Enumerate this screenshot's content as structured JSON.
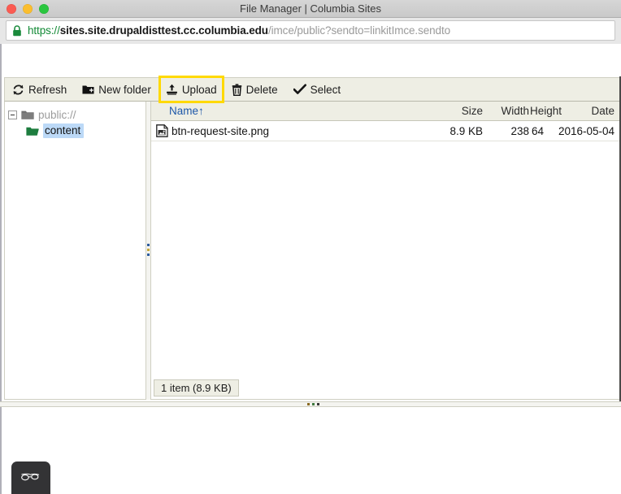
{
  "window": {
    "title": "File Manager | Columbia Sites",
    "traffic_lights": [
      {
        "name": "close",
        "color": "#fb5b52"
      },
      {
        "name": "minimize",
        "color": "#fbbe2e"
      },
      {
        "name": "maximize",
        "color": "#2ac63f"
      }
    ]
  },
  "urlbar": {
    "lock_icon": "padlock-icon",
    "scheme": "https",
    "separator": "://",
    "host": "sites.site.drupaldisttest.cc.columbia.edu",
    "path": "/imce/public?sendto=linkitImce.sendto",
    "full_url": "https://sites.site.drupaldisttest.cc.columbia.edu/imce/public?sendto=linkitImce.sendto",
    "scheme_color": "#138a36",
    "host_color": "#181818",
    "path_color": "#9a9a9a"
  },
  "toolbar": {
    "buttons": [
      {
        "label": "Refresh",
        "icon": "refresh-icon",
        "highlighted": false
      },
      {
        "label": "New folder",
        "icon": "new-folder-icon",
        "highlighted": false
      },
      {
        "label": "Upload",
        "icon": "upload-icon",
        "highlighted": true
      },
      {
        "label": "Delete",
        "icon": "trash-icon",
        "highlighted": false
      },
      {
        "label": "Select",
        "icon": "checkmark-icon",
        "highlighted": false
      }
    ],
    "highlight_color": "#ffd900"
  },
  "tree": {
    "nodes": [
      {
        "label": "public://",
        "icon": "folder-closed-icon",
        "expanded": true,
        "selected": false,
        "level": 1
      },
      {
        "label": "content",
        "icon": "folder-open-icon",
        "expanded": false,
        "selected": true,
        "level": 2
      }
    ],
    "selection_color": "#bcd9f7"
  },
  "filelist": {
    "columns": [
      {
        "key": "name",
        "label": "Name",
        "sorted": true,
        "sort_indicator": "↑"
      },
      {
        "key": "size",
        "label": "Size",
        "sorted": false
      },
      {
        "key": "width",
        "label": "Width",
        "sorted": false
      },
      {
        "key": "height",
        "label": "Height",
        "sorted": false
      },
      {
        "key": "date",
        "label": "Date",
        "sorted": false
      }
    ],
    "name_header_with_arrow": "Name↑",
    "rows": [
      {
        "icon": "image-file-icon",
        "name": "btn-request-site.png",
        "size": "8.9 KB",
        "width": "238",
        "height": "64",
        "date": "2016-05-04"
      }
    ],
    "status": "1 item (8.9 KB)"
  },
  "lower": {
    "reader_badge_icon": "glasses-icon",
    "reader_badge_color": "#333335"
  }
}
